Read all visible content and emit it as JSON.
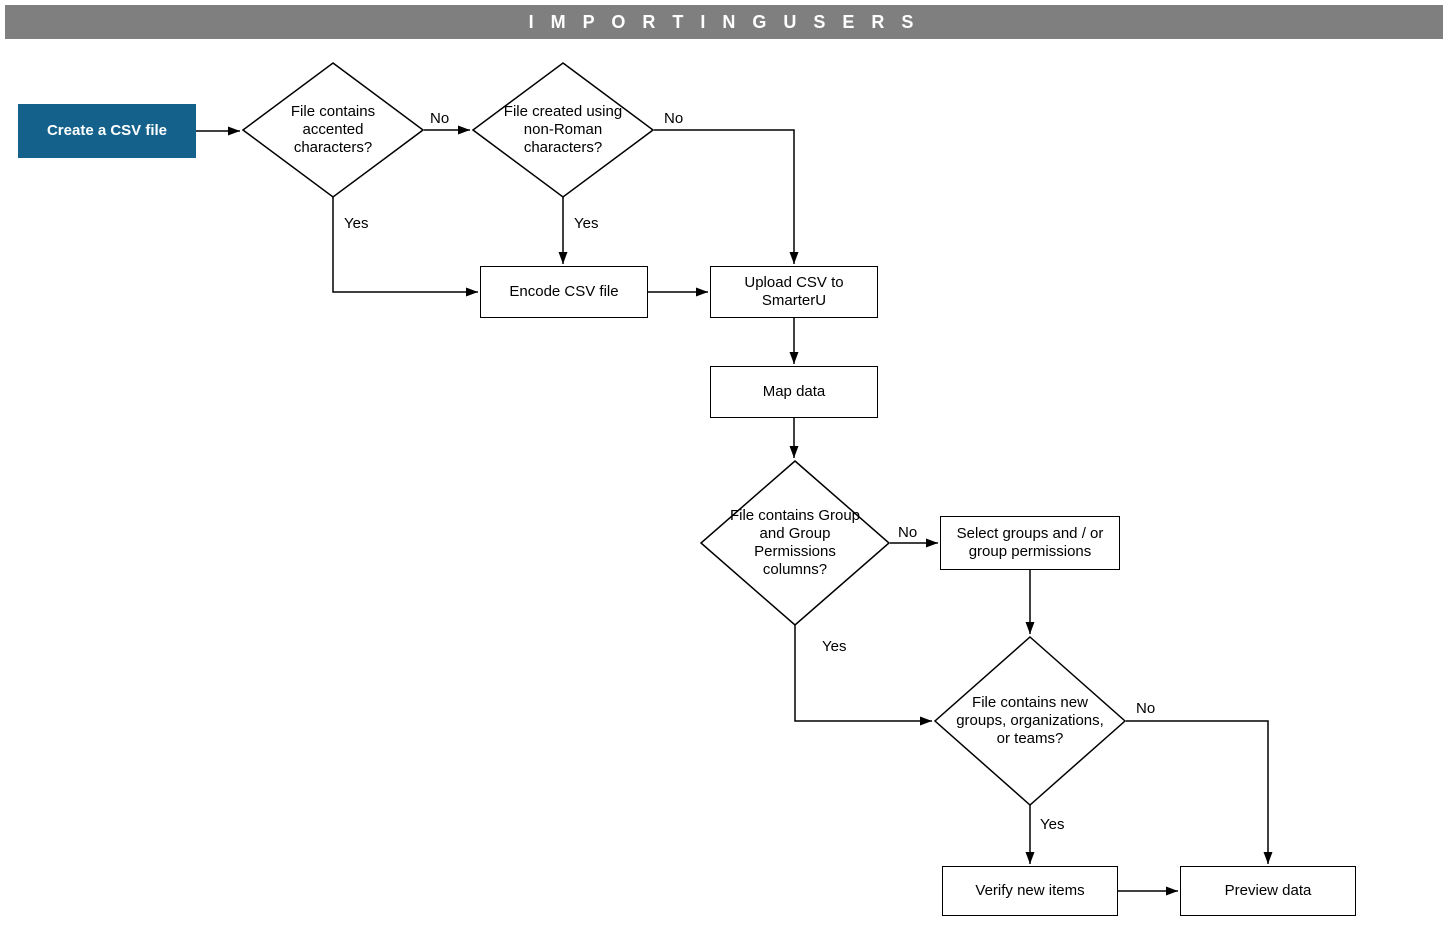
{
  "header": {
    "title": "I M P O R T I N G   U S E R S"
  },
  "nodes": {
    "start": "Create a CSV file",
    "d_accented": "File contains accented characters?",
    "d_nonroman": "File created using non-Roman characters?",
    "encode": "Encode CSV file",
    "upload": "Upload CSV to SmarterU",
    "map": "Map data",
    "d_groupcols": "File contains Group and Group Permissions columns?",
    "selgroups": "Select groups and / or group permissions",
    "d_neworg": "File contains new groups, organizations, or teams?",
    "verify": "Verify new items",
    "preview": "Preview data"
  },
  "labels": {
    "yes": "Yes",
    "no": "No"
  }
}
